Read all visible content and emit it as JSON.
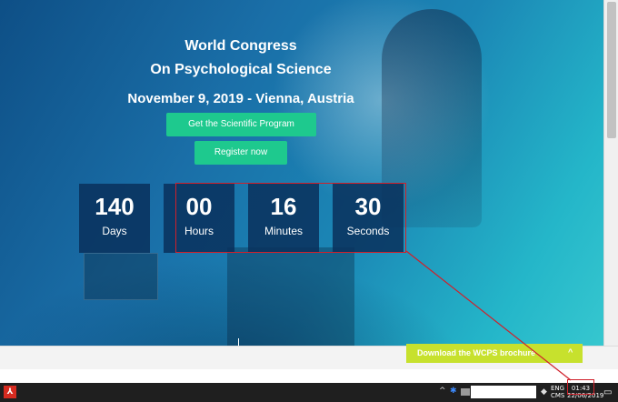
{
  "hero": {
    "title_line1": "World Congress",
    "title_line2": "On Psychological Science",
    "date_location": "November 9, 2019 - Vienna, Austria"
  },
  "buttons": {
    "program": "Get the Scientific Program",
    "register": "Register now"
  },
  "countdown": [
    {
      "value": "140",
      "label": "Days"
    },
    {
      "value": "00",
      "label": "Hours"
    },
    {
      "value": "16",
      "label": "Minutes"
    },
    {
      "value": "30",
      "label": "Seconds"
    }
  ],
  "brochure": {
    "label": "Download the WCPS brochure",
    "chevron": "^"
  },
  "taskbar": {
    "lang_line1": "ENG",
    "lang_line2": "CMS",
    "time": "01:43",
    "date": "22/06/2019",
    "pdf_icon": "pdf-icon"
  },
  "colors": {
    "accent_green": "#1ec98e",
    "brochure_lime": "#c7e12d",
    "highlight_red": "#d0202a",
    "countdown_bg": "#09305c"
  }
}
